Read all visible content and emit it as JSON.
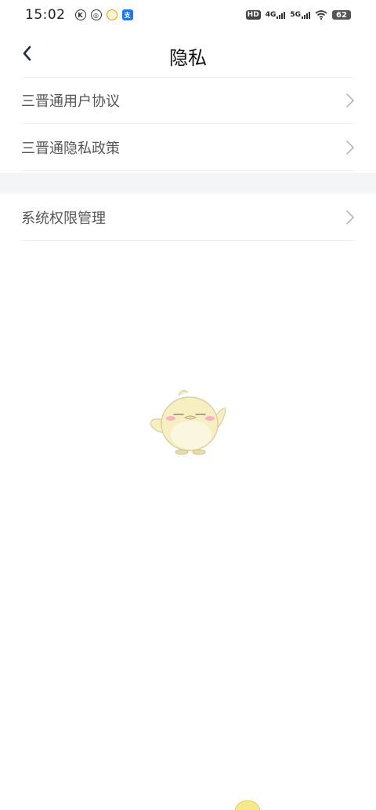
{
  "status_bar": {
    "time": "15:02",
    "alipay_glyph": "支",
    "hd_label": "HD",
    "sim1_label": "4G",
    "sim2_label": "5G",
    "battery": "62"
  },
  "header": {
    "title": "隐私"
  },
  "menu": {
    "group1": [
      {
        "label": "三晋通用户协议"
      },
      {
        "label": "三晋通隐私政策"
      }
    ],
    "group2": [
      {
        "label": "系统权限管理"
      }
    ]
  },
  "icons": {
    "back": "chevron-left-icon",
    "item_arrow": "chevron-right-icon",
    "mascot": "chick-mascot-illustration"
  },
  "colors": {
    "divider": "#eeeeee",
    "section_bg": "#f4f5f7",
    "label_text": "#555555",
    "chevron": "#b8b8b8",
    "mascot_body": "#f7efc2"
  }
}
